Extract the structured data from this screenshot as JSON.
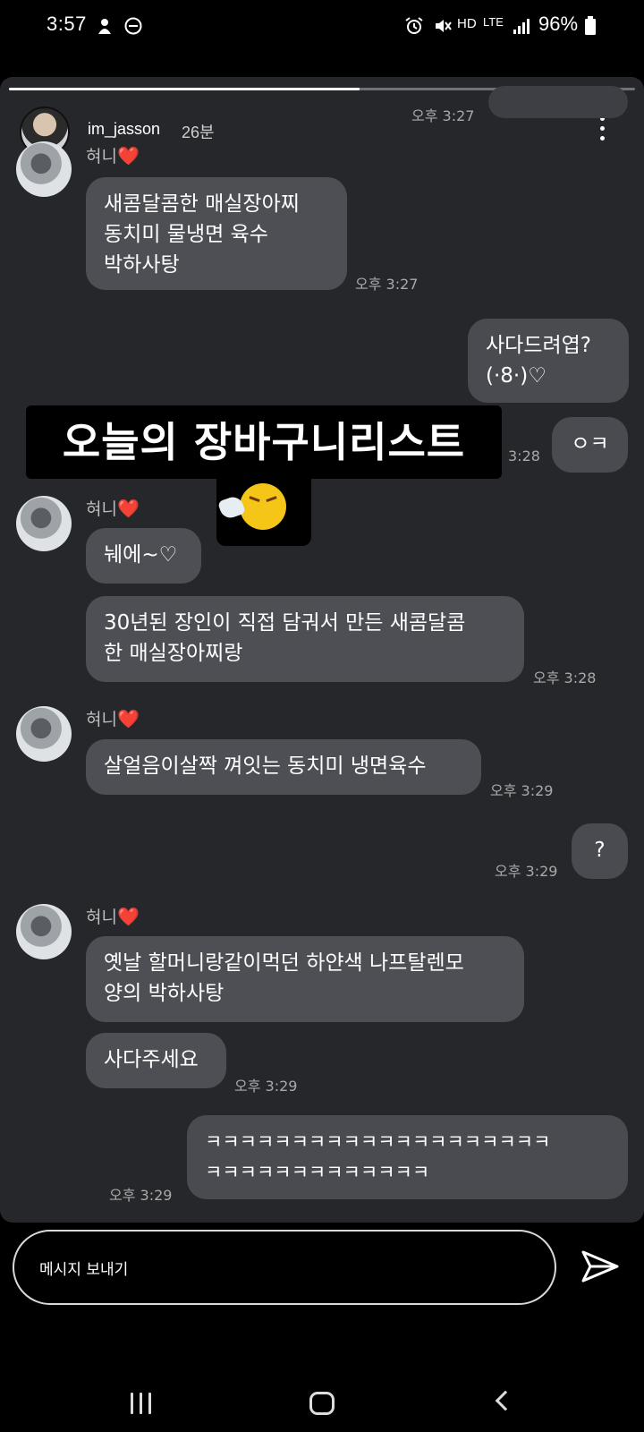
{
  "status_bar": {
    "time": "3:57",
    "right_labels": [
      "HD",
      "LTE"
    ],
    "battery": "96%"
  },
  "story": {
    "progress": 0.56,
    "username": "im_jasson",
    "age": "26분"
  },
  "sticker": {
    "text": "오늘의 장바구니리스트",
    "emoji": "sneezing-face-icon"
  },
  "messages": {
    "top_ts": "오후 3:27",
    "sender_name": "혀니",
    "heart": "❤️",
    "m1": "새콤달콤한 매실장아찌\n동치미 물냉면 육수\n박하사탕",
    "m1_ts": "오후 3:27",
    "m2": "사다드려엽?\n(·8·)♡",
    "m3": "ㅇㅋ",
    "m3_ts": "3:28",
    "m4": "눼에~♡",
    "m5": "30년된 장인이 직접 담궈서 만든 새콤달콤\n한 매실장아찌랑",
    "m5_ts": "오후 3:28",
    "m6": "살얼음이살짝 껴잇는 동치미 냉면육수",
    "m6_ts": "오후 3:29",
    "m7": "?",
    "m7_ts": "오후 3:29",
    "m8": "옛날 할머니랑같이먹던 하얀색 나프탈렌모\n양의 박하사탕",
    "m9": "사다주세요",
    "m9_ts": "오후 3:29",
    "m10": "ㅋㅋㅋㅋㅋㅋㅋㅋㅋㅋㅋㅋㅋㅋㅋㅋㅋㅋㅋㅋ\nㅋㅋㅋㅋㅋㅋㅋㅋㅋㅋㅋㅋㅋ",
    "m10_ts": "오후 3:29"
  },
  "composer": {
    "placeholder": "메시지 보내기"
  },
  "colors": {
    "panel": "#26272b",
    "bubble_in": "#4e4f55",
    "bubble_out": "#3e3f44",
    "heart": "#e52b3a"
  }
}
